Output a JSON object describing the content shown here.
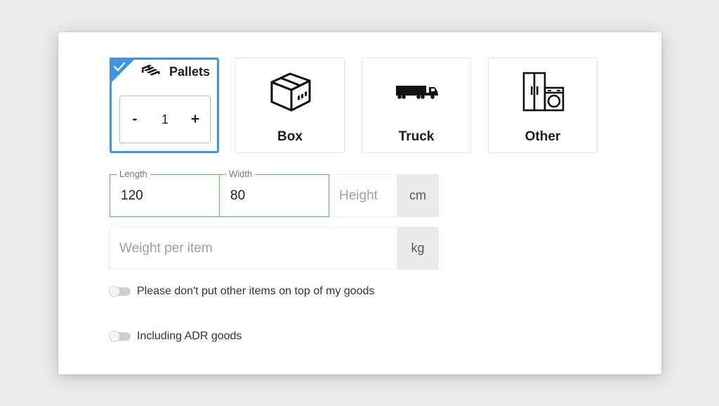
{
  "colors": {
    "accent_selected": "#3f95df",
    "field_active_border": "#5cb85c",
    "unit_background": "#ebebeb"
  },
  "cargo_types": [
    {
      "label": "Pallets",
      "icon": "pallet-icon",
      "selected": true
    },
    {
      "label": "Box",
      "icon": "box-icon",
      "selected": false
    },
    {
      "label": "Truck",
      "icon": "truck-icon",
      "selected": false
    },
    {
      "label": "Other",
      "icon": "appliances-icon",
      "selected": false
    }
  ],
  "quantity": {
    "decrement_label": "-",
    "value": "1",
    "increment_label": "+"
  },
  "dimensions": {
    "length": {
      "label": "Length",
      "value": "120"
    },
    "width": {
      "label": "Width",
      "value": "80"
    },
    "height": {
      "placeholder": "Height"
    },
    "unit": "cm"
  },
  "weight": {
    "placeholder": "Weight per item",
    "unit": "kg"
  },
  "options": {
    "no_stacking": {
      "label": "Please don't put other items on top of my goods",
      "enabled": false
    },
    "adr_goods": {
      "label": "Including ADR goods",
      "enabled": false
    }
  }
}
